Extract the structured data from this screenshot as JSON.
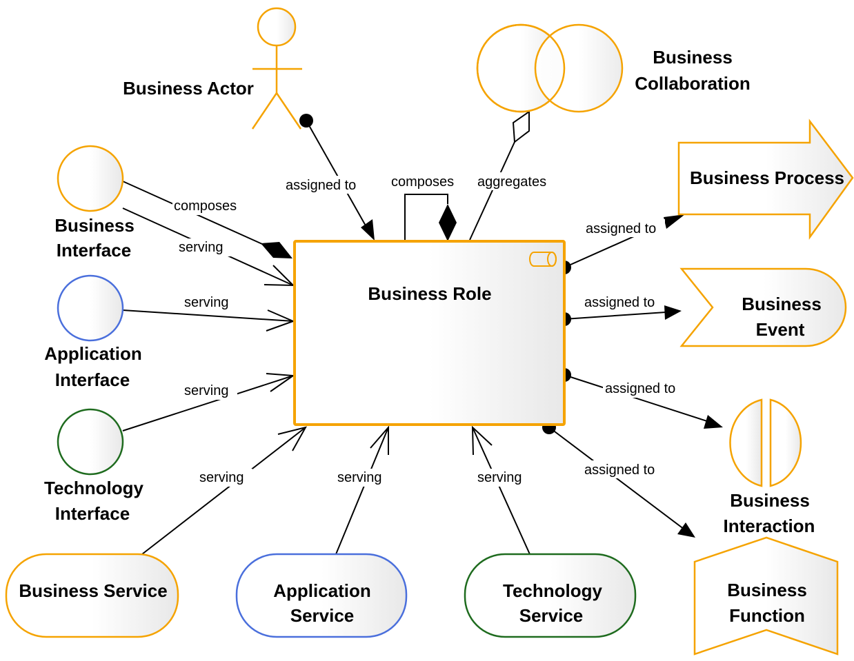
{
  "diagram": {
    "colors": {
      "business": "#f5a300",
      "application": "#4a6fdc",
      "technology": "#1e6b1e",
      "edge": "#000000"
    },
    "center": {
      "id": "role",
      "label": "Business Role",
      "type": "business-role",
      "icon": "role-cylinder-icon"
    },
    "nodes": [
      {
        "id": "actor",
        "lines": [
          "Business Actor"
        ],
        "type": "business-actor",
        "layer": "business"
      },
      {
        "id": "collab",
        "lines": [
          "Business",
          "Collaboration"
        ],
        "type": "business-collaboration",
        "layer": "business"
      },
      {
        "id": "process",
        "lines": [
          "Business Process"
        ],
        "type": "business-process",
        "layer": "business"
      },
      {
        "id": "event",
        "lines": [
          "Business",
          "Event"
        ],
        "type": "business-event",
        "layer": "business"
      },
      {
        "id": "interaction",
        "lines": [
          "Business",
          "Interaction"
        ],
        "type": "business-interaction",
        "layer": "business"
      },
      {
        "id": "function",
        "lines": [
          "Business",
          "Function"
        ],
        "type": "business-function",
        "layer": "business"
      },
      {
        "id": "bizif",
        "lines": [
          "Business",
          "Interface"
        ],
        "type": "interface",
        "layer": "business"
      },
      {
        "id": "appif",
        "lines": [
          "Application",
          "Interface"
        ],
        "type": "interface",
        "layer": "application"
      },
      {
        "id": "techif",
        "lines": [
          "Technology",
          "Interface"
        ],
        "type": "interface",
        "layer": "technology"
      },
      {
        "id": "bizsvc",
        "lines": [
          "Business Service"
        ],
        "type": "service",
        "layer": "business"
      },
      {
        "id": "appsvc",
        "lines": [
          "Application",
          "Service"
        ],
        "type": "service",
        "layer": "application"
      },
      {
        "id": "techsvc",
        "lines": [
          "Technology",
          "Service"
        ],
        "type": "service",
        "layer": "technology"
      }
    ],
    "edges": [
      {
        "from": "actor",
        "to": "role",
        "label": "assigned to",
        "kind": "assignment"
      },
      {
        "from": "role",
        "to": "role",
        "label": "composes",
        "kind": "composition"
      },
      {
        "from": "collab",
        "to": "role",
        "label": "aggregates",
        "kind": "aggregation"
      },
      {
        "from": "role",
        "to": "process",
        "label": "assigned to",
        "kind": "assignment"
      },
      {
        "from": "role",
        "to": "event",
        "label": "assigned to",
        "kind": "assignment"
      },
      {
        "from": "role",
        "to": "interaction",
        "label": "assigned to",
        "kind": "assignment"
      },
      {
        "from": "role",
        "to": "function",
        "label": "assigned to",
        "kind": "assignment"
      },
      {
        "from": "bizif",
        "to": "role",
        "label": "composes",
        "kind": "composition"
      },
      {
        "from": "bizif",
        "to": "role",
        "label": "serving",
        "kind": "serving"
      },
      {
        "from": "appif",
        "to": "role",
        "label": "serving",
        "kind": "serving"
      },
      {
        "from": "techif",
        "to": "role",
        "label": "serving",
        "kind": "serving"
      },
      {
        "from": "bizsvc",
        "to": "role",
        "label": "serving",
        "kind": "serving"
      },
      {
        "from": "appsvc",
        "to": "role",
        "label": "serving",
        "kind": "serving"
      },
      {
        "from": "techsvc",
        "to": "role",
        "label": "serving",
        "kind": "serving"
      }
    ]
  }
}
